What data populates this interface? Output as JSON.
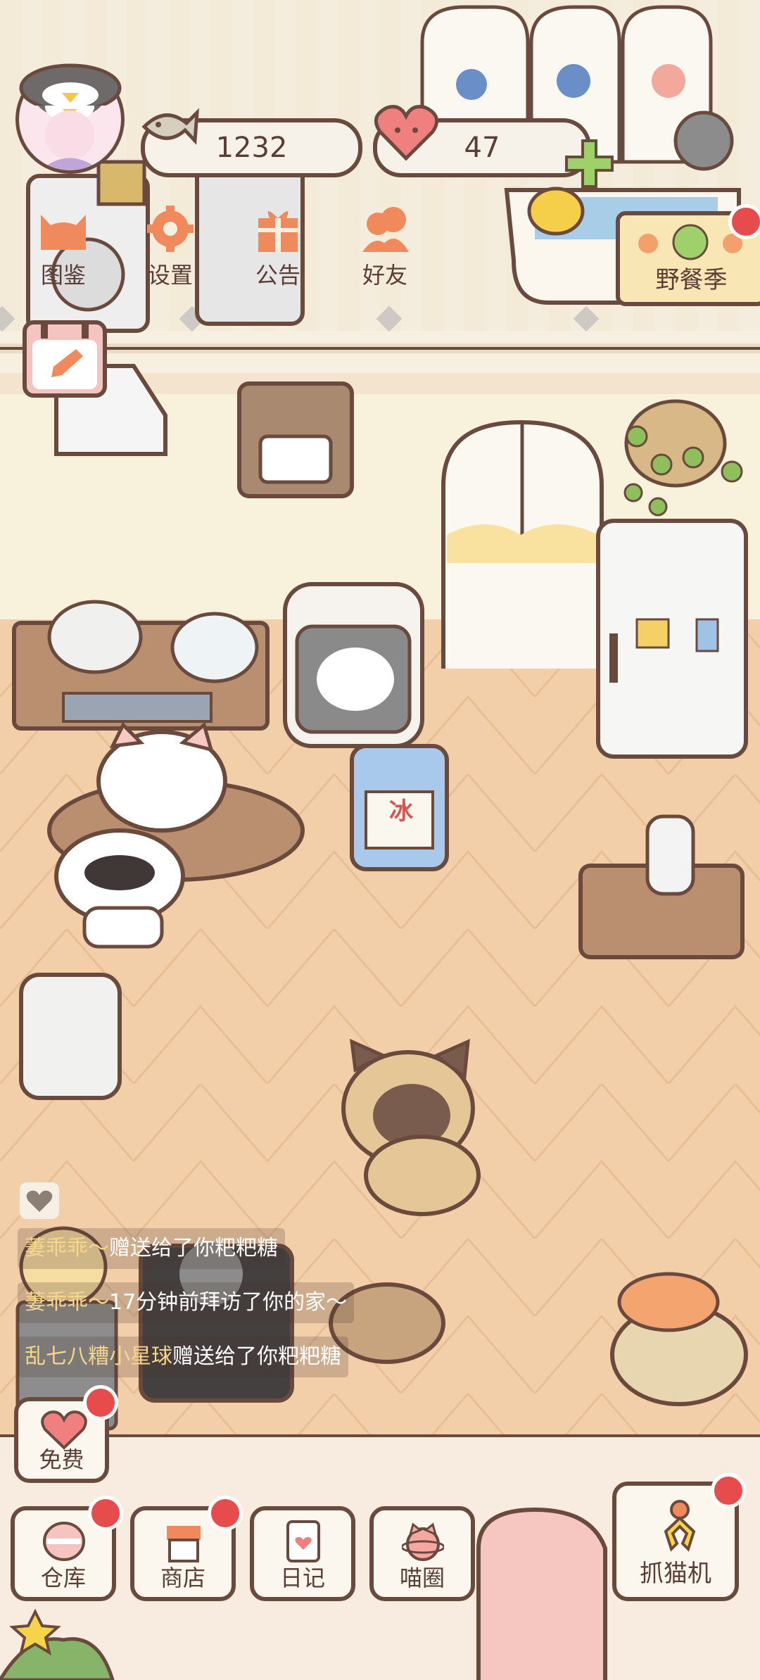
{
  "currency": {
    "fish_icon": "fish-icon",
    "fish_value": "1232",
    "heart_icon": "heart-icon",
    "heart_value": "47",
    "add_icon": "plus-icon"
  },
  "top_menu": {
    "items": [
      {
        "label": "图鉴",
        "icon": "cat-head-icon"
      },
      {
        "label": "设置",
        "icon": "gear-icon"
      },
      {
        "label": "公告",
        "icon": "gift-icon"
      },
      {
        "label": "好友",
        "icon": "friends-icon"
      }
    ]
  },
  "event": {
    "label": "野餐季",
    "icon": "apple-icon"
  },
  "feed": {
    "items": [
      {
        "name": "萋乖乖～",
        "message": "赠送给了你粑粑糖"
      },
      {
        "name": "萋乖乖～",
        "message": "17分钟前拜访了你的家～"
      },
      {
        "name": "乱七八糟小星球",
        "message": "赠送给了你粑粑糖"
      }
    ]
  },
  "free_button": {
    "label": "免费",
    "icon": "heart-icon"
  },
  "bottom_nav": {
    "items": [
      {
        "label": "仓库",
        "icon": "storage-icon"
      },
      {
        "label": "商店",
        "icon": "shop-icon"
      },
      {
        "label": "日记",
        "icon": "diary-icon"
      },
      {
        "label": "喵圈",
        "icon": "planet-cat-icon"
      }
    ],
    "claw_label": "抓猫机",
    "claw_icon": "claw-icon"
  },
  "fridge_sign": "冰",
  "colors": {
    "outline": "#6b4a3e",
    "floor": "#f2cfa9",
    "wall": "#f8f1dc",
    "accent_red": "#e74c4c",
    "orange": "#f08a5d"
  }
}
